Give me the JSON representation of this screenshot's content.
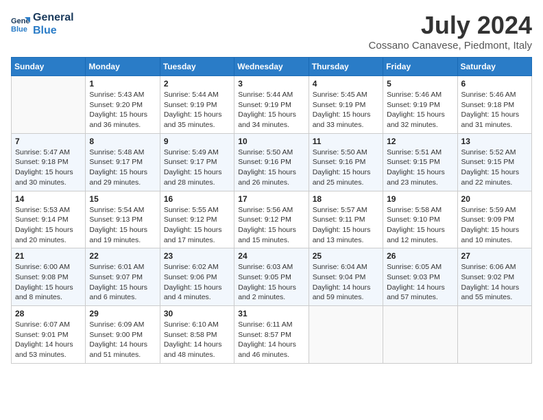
{
  "logo": {
    "line1": "General",
    "line2": "Blue"
  },
  "title": "July 2024",
  "location": "Cossano Canavese, Piedmont, Italy",
  "weekdays": [
    "Sunday",
    "Monday",
    "Tuesday",
    "Wednesday",
    "Thursday",
    "Friday",
    "Saturday"
  ],
  "weeks": [
    [
      {
        "day": "",
        "info": ""
      },
      {
        "day": "1",
        "info": "Sunrise: 5:43 AM\nSunset: 9:20 PM\nDaylight: 15 hours\nand 36 minutes."
      },
      {
        "day": "2",
        "info": "Sunrise: 5:44 AM\nSunset: 9:19 PM\nDaylight: 15 hours\nand 35 minutes."
      },
      {
        "day": "3",
        "info": "Sunrise: 5:44 AM\nSunset: 9:19 PM\nDaylight: 15 hours\nand 34 minutes."
      },
      {
        "day": "4",
        "info": "Sunrise: 5:45 AM\nSunset: 9:19 PM\nDaylight: 15 hours\nand 33 minutes."
      },
      {
        "day": "5",
        "info": "Sunrise: 5:46 AM\nSunset: 9:19 PM\nDaylight: 15 hours\nand 32 minutes."
      },
      {
        "day": "6",
        "info": "Sunrise: 5:46 AM\nSunset: 9:18 PM\nDaylight: 15 hours\nand 31 minutes."
      }
    ],
    [
      {
        "day": "7",
        "info": "Sunrise: 5:47 AM\nSunset: 9:18 PM\nDaylight: 15 hours\nand 30 minutes."
      },
      {
        "day": "8",
        "info": "Sunrise: 5:48 AM\nSunset: 9:17 PM\nDaylight: 15 hours\nand 29 minutes."
      },
      {
        "day": "9",
        "info": "Sunrise: 5:49 AM\nSunset: 9:17 PM\nDaylight: 15 hours\nand 28 minutes."
      },
      {
        "day": "10",
        "info": "Sunrise: 5:50 AM\nSunset: 9:16 PM\nDaylight: 15 hours\nand 26 minutes."
      },
      {
        "day": "11",
        "info": "Sunrise: 5:50 AM\nSunset: 9:16 PM\nDaylight: 15 hours\nand 25 minutes."
      },
      {
        "day": "12",
        "info": "Sunrise: 5:51 AM\nSunset: 9:15 PM\nDaylight: 15 hours\nand 23 minutes."
      },
      {
        "day": "13",
        "info": "Sunrise: 5:52 AM\nSunset: 9:15 PM\nDaylight: 15 hours\nand 22 minutes."
      }
    ],
    [
      {
        "day": "14",
        "info": "Sunrise: 5:53 AM\nSunset: 9:14 PM\nDaylight: 15 hours\nand 20 minutes."
      },
      {
        "day": "15",
        "info": "Sunrise: 5:54 AM\nSunset: 9:13 PM\nDaylight: 15 hours\nand 19 minutes."
      },
      {
        "day": "16",
        "info": "Sunrise: 5:55 AM\nSunset: 9:12 PM\nDaylight: 15 hours\nand 17 minutes."
      },
      {
        "day": "17",
        "info": "Sunrise: 5:56 AM\nSunset: 9:12 PM\nDaylight: 15 hours\nand 15 minutes."
      },
      {
        "day": "18",
        "info": "Sunrise: 5:57 AM\nSunset: 9:11 PM\nDaylight: 15 hours\nand 13 minutes."
      },
      {
        "day": "19",
        "info": "Sunrise: 5:58 AM\nSunset: 9:10 PM\nDaylight: 15 hours\nand 12 minutes."
      },
      {
        "day": "20",
        "info": "Sunrise: 5:59 AM\nSunset: 9:09 PM\nDaylight: 15 hours\nand 10 minutes."
      }
    ],
    [
      {
        "day": "21",
        "info": "Sunrise: 6:00 AM\nSunset: 9:08 PM\nDaylight: 15 hours\nand 8 minutes."
      },
      {
        "day": "22",
        "info": "Sunrise: 6:01 AM\nSunset: 9:07 PM\nDaylight: 15 hours\nand 6 minutes."
      },
      {
        "day": "23",
        "info": "Sunrise: 6:02 AM\nSunset: 9:06 PM\nDaylight: 15 hours\nand 4 minutes."
      },
      {
        "day": "24",
        "info": "Sunrise: 6:03 AM\nSunset: 9:05 PM\nDaylight: 15 hours\nand 2 minutes."
      },
      {
        "day": "25",
        "info": "Sunrise: 6:04 AM\nSunset: 9:04 PM\nDaylight: 14 hours\nand 59 minutes."
      },
      {
        "day": "26",
        "info": "Sunrise: 6:05 AM\nSunset: 9:03 PM\nDaylight: 14 hours\nand 57 minutes."
      },
      {
        "day": "27",
        "info": "Sunrise: 6:06 AM\nSunset: 9:02 PM\nDaylight: 14 hours\nand 55 minutes."
      }
    ],
    [
      {
        "day": "28",
        "info": "Sunrise: 6:07 AM\nSunset: 9:01 PM\nDaylight: 14 hours\nand 53 minutes."
      },
      {
        "day": "29",
        "info": "Sunrise: 6:09 AM\nSunset: 9:00 PM\nDaylight: 14 hours\nand 51 minutes."
      },
      {
        "day": "30",
        "info": "Sunrise: 6:10 AM\nSunset: 8:58 PM\nDaylight: 14 hours\nand 48 minutes."
      },
      {
        "day": "31",
        "info": "Sunrise: 6:11 AM\nSunset: 8:57 PM\nDaylight: 14 hours\nand 46 minutes."
      },
      {
        "day": "",
        "info": ""
      },
      {
        "day": "",
        "info": ""
      },
      {
        "day": "",
        "info": ""
      }
    ]
  ]
}
